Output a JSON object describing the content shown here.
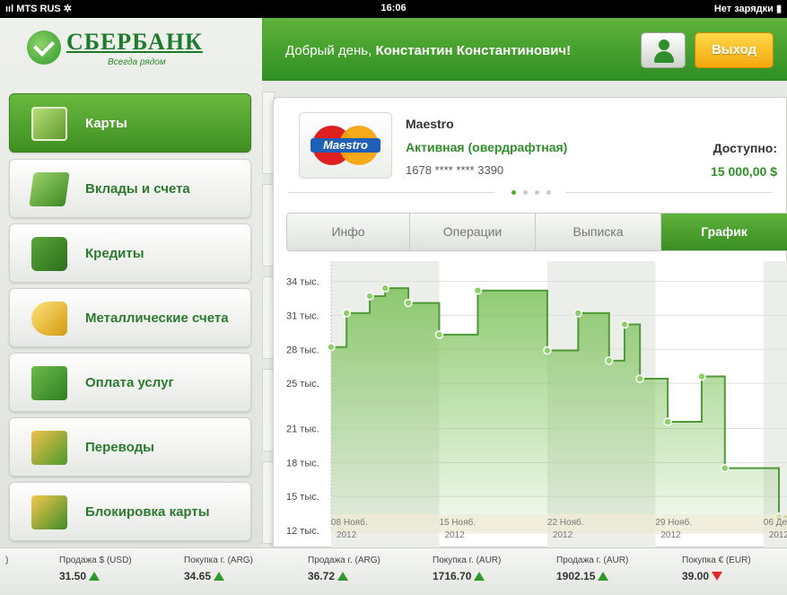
{
  "status_bar": {
    "carrier": "ııl MTS RUS ✲",
    "time": "16:06",
    "battery": "Нет зарядки ▮"
  },
  "logo": {
    "title": "СБЕРБАНК",
    "subtitle": "Всегда рядом"
  },
  "header": {
    "greeting_prefix": "Добрый день, ",
    "user_name": "Константин Константинович!",
    "logout_label": "Выход"
  },
  "sidebar": {
    "items": [
      {
        "label": "Карты",
        "icon": "card-wallet-icon",
        "active": true
      },
      {
        "label": "Вклады и счета",
        "icon": "banknotes-icon",
        "active": false
      },
      {
        "label": "Кредиты",
        "icon": "wallet-icon",
        "active": false
      },
      {
        "label": "Металлические счета",
        "icon": "gold-bars-icon",
        "active": false
      },
      {
        "label": "Оплата услуг",
        "icon": "case-coin-icon",
        "active": false
      },
      {
        "label": "Переводы",
        "icon": "money-transfer-icon",
        "active": false
      },
      {
        "label": "Блокировка карты",
        "icon": "lock-icon",
        "active": false
      }
    ]
  },
  "card": {
    "logo_text": "Maestro",
    "name": "Maestro",
    "status": "Активная (овердрафтная)",
    "number": "1678 **** **** 3390",
    "available_label": "Доступно:",
    "available_value": "15 000,00 $",
    "page_dots": 4,
    "active_dot": 0
  },
  "tabs": [
    {
      "label": "Инфо",
      "active": false
    },
    {
      "label": "Операции",
      "active": false
    },
    {
      "label": "Выписка",
      "active": false
    },
    {
      "label": "График",
      "active": true
    }
  ],
  "chart_data": {
    "type": "line",
    "step": true,
    "ylabel": "",
    "ytick_labels": [
      "12 тыс.",
      "15 тыс.",
      "18 тыс.",
      "21 тыс.",
      "25 тыс.",
      "28 тыс.",
      "31 тыс.",
      "34 тыс."
    ],
    "xtick_labels": [
      {
        "day": "08 Нояб.",
        "year": "2012"
      },
      {
        "day": "15 Нояб.",
        "year": "2012"
      },
      {
        "day": "22 Нояб.",
        "year": "2012"
      },
      {
        "day": "29 Нояб.",
        "year": "2012"
      },
      {
        "day": "06 Дек.",
        "year": "2012"
      }
    ],
    "series": [
      {
        "points": [
          {
            "x": 0,
            "y": 28.2
          },
          {
            "x": 1,
            "y": 31.2
          },
          {
            "x": 2.5,
            "y": 32.7
          },
          {
            "x": 3.5,
            "y": 33.4
          },
          {
            "x": 5.0,
            "y": 32.1
          },
          {
            "x": 7.0,
            "y": 29.3
          },
          {
            "x": 9.5,
            "y": 33.2
          },
          {
            "x": 14.0,
            "y": 27.9
          },
          {
            "x": 16.0,
            "y": 31.2
          },
          {
            "x": 18.0,
            "y": 27.0
          },
          {
            "x": 19.0,
            "y": 30.2
          },
          {
            "x": 20.0,
            "y": 25.4
          },
          {
            "x": 21.8,
            "y": 21.6
          },
          {
            "x": 24.0,
            "y": 25.6
          },
          {
            "x": 25.5,
            "y": 17.5
          },
          {
            "x": 29.0,
            "y": 13.2
          }
        ]
      }
    ],
    "ylim": [
      12,
      35
    ],
    "grid": true,
    "colors": {
      "line": "#4f9a36",
      "fill": "#7cc25a"
    }
  },
  "ticker": [
    {
      "label": "Продажа $ (USD)",
      "value": "31.50",
      "trend": "up"
    },
    {
      "label": "Покупка г. (ARG)",
      "value": "34.65",
      "trend": "up"
    },
    {
      "label": "Продажа г. (ARG)",
      "value": "36.72",
      "trend": "up"
    },
    {
      "label": "Покупка г. (AUR)",
      "value": "1716.70",
      "trend": "up"
    },
    {
      "label": "Продажа г. (AUR)",
      "value": "1902.15",
      "trend": "up"
    },
    {
      "label": "Покупка € (EUR)",
      "value": "39.00",
      "trend": "down"
    }
  ],
  "ticker_clipped": ")"
}
